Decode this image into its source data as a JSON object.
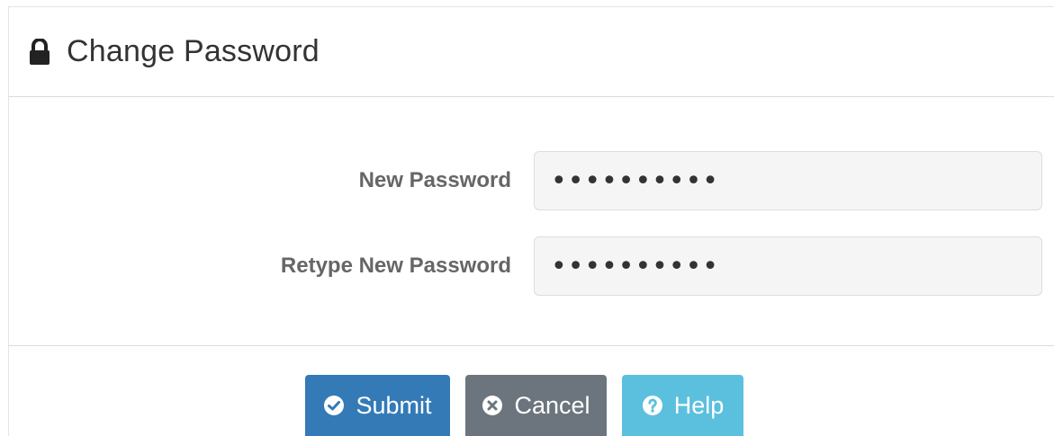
{
  "header": {
    "title": "Change Password",
    "icon": "lock-icon"
  },
  "form": {
    "new_password": {
      "label": "New Password",
      "value": "••••••••••"
    },
    "retype_password": {
      "label": "Retype New Password",
      "value": "••••••••••"
    }
  },
  "footer": {
    "submit_label": "Submit",
    "cancel_label": "Cancel",
    "help_label": "Help"
  },
  "colors": {
    "submit": "#337ab7",
    "cancel": "#6c757d",
    "help": "#5bc0de"
  }
}
